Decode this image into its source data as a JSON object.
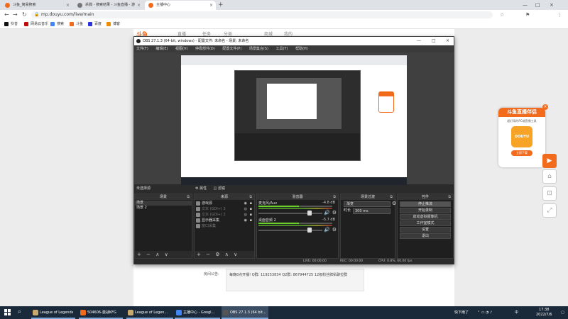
{
  "browser": {
    "tabs": [
      {
        "title": "斗鱼_简易搜索",
        "color": "#f26b1d"
      },
      {
        "title": "杀戮 - 搜索结果 - 斗鱼直播 - 游",
        "color": "#777"
      },
      {
        "title": "主播中心",
        "color": "#f26b1d"
      }
    ],
    "new_tab": "+",
    "window_controls": [
      "—",
      "□",
      "×"
    ],
    "nav": [
      "←",
      "→",
      "↻"
    ],
    "url": "mp.douyu.com/live/main",
    "lock_icon": "🔒",
    "right_icons": [
      "☆",
      "⚑",
      "⋮"
    ],
    "bookmarks": [
      {
        "label": "抖音",
        "color": "#111"
      },
      {
        "label": "网易云音乐",
        "color": "#c20c0c"
      },
      {
        "label": "搜索",
        "color": "#4285f4"
      },
      {
        "label": "斗鱼",
        "color": "#f26b1d"
      },
      {
        "label": "百度",
        "color": "#2932e1"
      },
      {
        "label": "博客",
        "color": "#f08a00"
      }
    ]
  },
  "page": {
    "logo": "斗鱼",
    "nav_items": [
      "直播",
      "任务",
      "分类",
      "商城",
      "我的"
    ],
    "notice_label": "房间公告:",
    "notice_text": "每晚8点开播! Q群: 119253834 Q2群: 867944725 12级粉丝牌私聊拉群",
    "promo": {
      "title": "斗鱼直播伴侣",
      "subtitle": "超好用的PC端直播工具",
      "logo_text": "DOUYU",
      "button": "立即下载",
      "close": "×"
    },
    "side_buttons": [
      "▶",
      "⌂",
      "⊡",
      "⤢"
    ]
  },
  "obs": {
    "title": "OBS 27.1.3 (64-bit, windows) - 配置文件: 未命名 - 场景: 未命名",
    "window_controls": [
      "—",
      "□",
      "×"
    ],
    "menu": [
      "文件(F)",
      "编辑(E)",
      "视图(V)",
      "停靠部件(D)",
      "配置文件(P)",
      "场景集合(S)",
      "工具(T)",
      "帮助(H)"
    ],
    "no_source_label": "未选择源",
    "props_tabs": [
      "⚙ 属性",
      "◫ 滤镜"
    ],
    "scenes": {
      "header": "场景",
      "items": [
        "场景",
        "场景 2"
      ],
      "footer_icons": [
        "+",
        "−",
        "∧",
        "∨"
      ]
    },
    "sources": {
      "header": "来源",
      "items": [
        {
          "label": "游戏源",
          "dim": false
        },
        {
          "label": "文本 (GDI+) 3",
          "dim": true
        },
        {
          "label": "文本 (GDI+) 2",
          "dim": true
        },
        {
          "label": "显示器采集",
          "dim": false
        },
        {
          "label": "窗口采集",
          "dim": true
        }
      ],
      "footer_icons": [
        "+",
        "−",
        "⚙",
        "∧",
        "∨"
      ]
    },
    "mixer": {
      "header": "混音器",
      "channels": [
        {
          "name": "麦克风/Aux",
          "db": "-4.8 dB"
        },
        {
          "name": "桌面音频 2",
          "db": "-5.7 dB"
        }
      ]
    },
    "transitions": {
      "header": "场景过渡",
      "select": "渐变",
      "duration_label": "时长",
      "duration_value": "300 ms"
    },
    "controls": {
      "header": "控件",
      "buttons": [
        "停止推流",
        "开始录制",
        "启动虚拟摄像机",
        "工作室模式",
        "设置",
        "退出"
      ]
    },
    "status": {
      "live": "LIVE: 00:00:00",
      "rec": "REC: 00:00:00",
      "cpu": "CPU: 0.8%, 60.00 fps"
    }
  },
  "taskbar": {
    "apps": [
      {
        "label": "League of Legends",
        "color": "#c8aa6e",
        "active": false
      },
      {
        "label": "504606-激战KFG",
        "color": "#f26b1d",
        "active": false
      },
      {
        "label": "League of Legen...",
        "color": "#c8aa6e",
        "active": false
      },
      {
        "label": "主播中心 - Googl...",
        "color": "#4285f4",
        "active": false
      },
      {
        "label": "OBS 27.1.3 (64 bit...",
        "color": "#555",
        "active": true
      }
    ],
    "weather": "快下雨了",
    "time": "17:38",
    "date": "2022/7/6"
  }
}
